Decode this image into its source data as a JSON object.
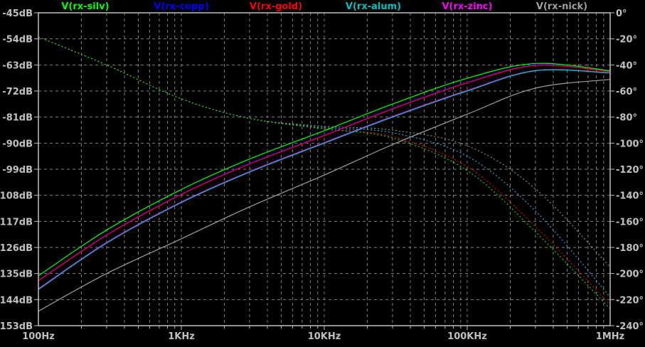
{
  "chart_data": {
    "type": "line",
    "title": "",
    "x_scale": "log",
    "xlim": [
      100,
      1000000
    ],
    "x_ticks": [
      {
        "v": 100,
        "label": "100Hz"
      },
      {
        "v": 1000,
        "label": "1KHz"
      },
      {
        "v": 10000,
        "label": "10KHz"
      },
      {
        "v": 100000,
        "label": "100KHz"
      },
      {
        "v": 1000000,
        "label": "1MHz"
      }
    ],
    "ylim_left": [
      -153,
      -45
    ],
    "y_ticks_left": [
      "-45dB",
      "-54dB",
      "-63dB",
      "-72dB",
      "-81dB",
      "-90dB",
      "-99dB",
      "-108dB",
      "-117dB",
      "-126dB",
      "-135dB",
      "-144dB",
      "-153dB"
    ],
    "ylim_right": [
      -240,
      0
    ],
    "y_ticks_right": [
      "0°",
      "-20°",
      "-40°",
      "-60°",
      "-80°",
      "-100°",
      "-120°",
      "-140°",
      "-160°",
      "-180°",
      "-200°",
      "-220°",
      "-240°"
    ],
    "grid": true,
    "legend_placement": "top",
    "x": [
      100,
      300,
      1000,
      3000,
      10000,
      30000,
      100000,
      300000,
      1000000
    ],
    "series": [
      {
        "name": "V(rx-silv)",
        "color": "#00ff00",
        "magnitude_db": [
          -135.8,
          -120,
          -106,
          -95.5,
          -85.7,
          -76.5,
          -67.6,
          -62.5,
          -65
        ],
        "phase_deg": [
          -18.5,
          -40,
          -66,
          -81,
          -89,
          -96,
          -121,
          -168,
          -227
        ]
      },
      {
        "name": "V(rx-copp)",
        "color": "#0000ff",
        "magnitude_db": [
          -137.3,
          -121.6,
          -107.5,
          -97,
          -87.2,
          -78,
          -69,
          -63,
          -65.2
        ],
        "phase_deg": [
          -18.5,
          -40,
          -66,
          -81,
          -89,
          -95,
          -118,
          -164,
          -224
        ]
      },
      {
        "name": "V(rx-gold)",
        "color": "#ff0000",
        "magnitude_db": [
          -137.5,
          -121.8,
          -107.7,
          -97.2,
          -87.4,
          -78.2,
          -69.2,
          -63.2,
          -65.3
        ],
        "phase_deg": [
          -18.5,
          -40,
          -66,
          -81,
          -89,
          -95,
          -118,
          -164,
          -224
        ]
      },
      {
        "name": "V(rx-alum)",
        "color": "#00c0c0",
        "magnitude_db": [
          -140.5,
          -124.5,
          -110.5,
          -100,
          -90,
          -81,
          -72,
          -65,
          -65.8
        ],
        "phase_deg": [
          -18.5,
          -40,
          -66,
          -81,
          -88,
          -92,
          -110,
          -152,
          -218
        ]
      },
      {
        "name": "V(rx-zinc)",
        "color": "#ff00ff",
        "magnitude_db": [
          -140.3,
          -124.3,
          -110.3,
          -99.8,
          -89.8,
          -80.8,
          -71.8,
          -64.9,
          -65.7
        ],
        "phase_deg": [
          -18.5,
          -40,
          -66,
          -81,
          -88,
          -92,
          -110,
          -152,
          -218
        ]
      },
      {
        "name": "V(rx-nick)",
        "color": "#a0a0a0",
        "magnitude_db": [
          -148,
          -135,
          -123,
          -112,
          -101,
          -90.5,
          -80,
          -71,
          -68
        ],
        "phase_deg": [
          -18.5,
          -40,
          -66,
          -81,
          -87,
          -90,
          -102,
          -135,
          -195
        ]
      }
    ]
  }
}
